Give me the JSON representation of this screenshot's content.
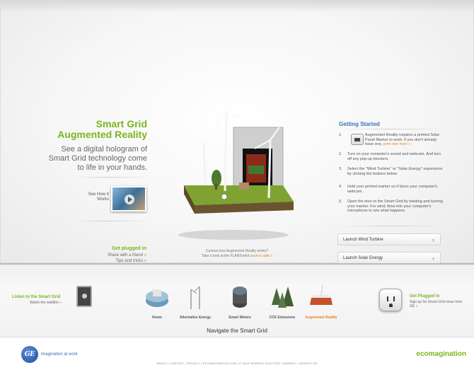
{
  "hero": {
    "title_line1": "Smart Grid",
    "title_line2": "Augmented Reality",
    "description": "See a digital hologram of Smart Grid technology come to life in your hands.",
    "see_how": "See How It Works"
  },
  "plugged_left": {
    "title": "Get plugged in",
    "links": [
      "Share with a friend",
      "Tips and tricks"
    ]
  },
  "center_caption": {
    "line1": "Curious how Augmented Reality works?",
    "line2": "Take a look at the FLARToolkit",
    "link": "source code"
  },
  "getting_started": {
    "title": "Getting Started",
    "steps": [
      {
        "num": "1.",
        "text": "Augmented Reality requires a printed Solar Panel Marker to work. If you don't already have one,",
        "link": "print one here"
      },
      {
        "num": "2.",
        "text": "Turn on your computer's sound and webcam. And turn off any pop-up blockers."
      },
      {
        "num": "3.",
        "text": "Select the \"Wind Turbine\" or \"Solar Energy\" experience by clicking the buttons below."
      },
      {
        "num": "4.",
        "text": "Hold your printed marker so it faces your computer's webcam."
      },
      {
        "num": "5.",
        "text": "Open the door to the Smart Grid by twisting and turning your marker. For wind, blow into your computer's microphone to see what happens."
      }
    ],
    "buttons": [
      "Launch Wind Turbine",
      "Launch Solar Energy"
    ]
  },
  "nav": {
    "listen_title": "Listen to the Smart Grid",
    "listen_sub": "Watch the webfilm",
    "items": [
      {
        "label": "Home",
        "icon": "home-icon"
      },
      {
        "label": "Alternative Energy",
        "icon": "wind-turbine-icon"
      },
      {
        "label": "Smart Meters",
        "icon": "meter-icon"
      },
      {
        "label": "CO2 Emissions",
        "icon": "trees-icon"
      },
      {
        "label": "Augmented Reality",
        "icon": "augmented-reality-icon",
        "active": true
      }
    ],
    "plugged_title": "Get Plugged In",
    "plugged_sub": "Sign up for Smart Grid news from GE",
    "navigate_label": "Navigate the Smart Grid"
  },
  "footer": {
    "ge_logo": "GE",
    "tagline": "imagination at work",
    "eco": "ecomagination",
    "links": "ABOUT | CONTACT | PRIVACY | ECOMAGINATION.COM | © 2009 GENERAL ELECTRIC COMPANY | SEARCH ON"
  },
  "colors": {
    "green": "#7ab51d",
    "blue": "#3a73b8",
    "orange": "#e8821e"
  }
}
